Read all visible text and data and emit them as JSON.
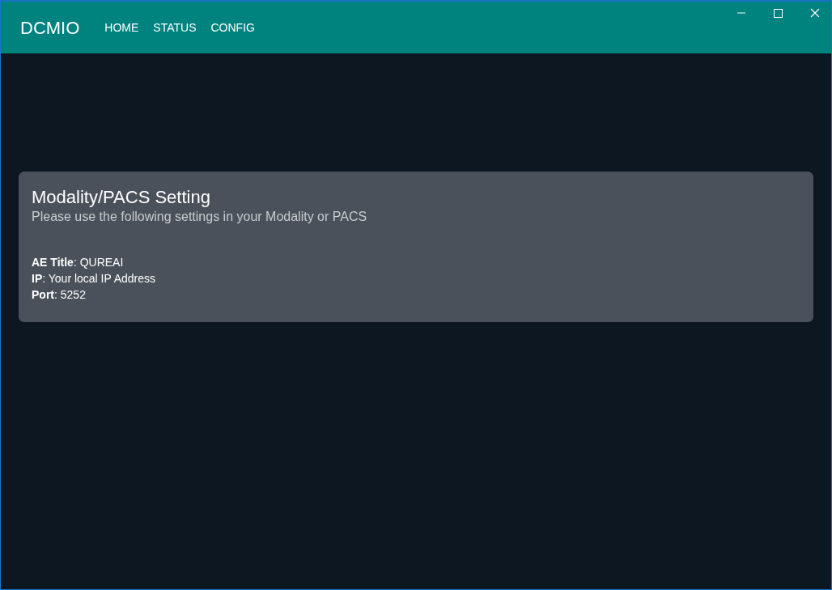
{
  "app": {
    "brand": "DCMIO"
  },
  "nav": [
    {
      "label": "HOME"
    },
    {
      "label": "STATUS"
    },
    {
      "label": "CONFIG"
    }
  ],
  "card": {
    "title": "Modality/PACS Setting",
    "subtitle": "Please use the following settings in your Modality or PACS",
    "settings": [
      "**AE Title**: QUREAI",
      "**IP**: Your local IP Address",
      "**Port**: 5252"
    ]
  }
}
